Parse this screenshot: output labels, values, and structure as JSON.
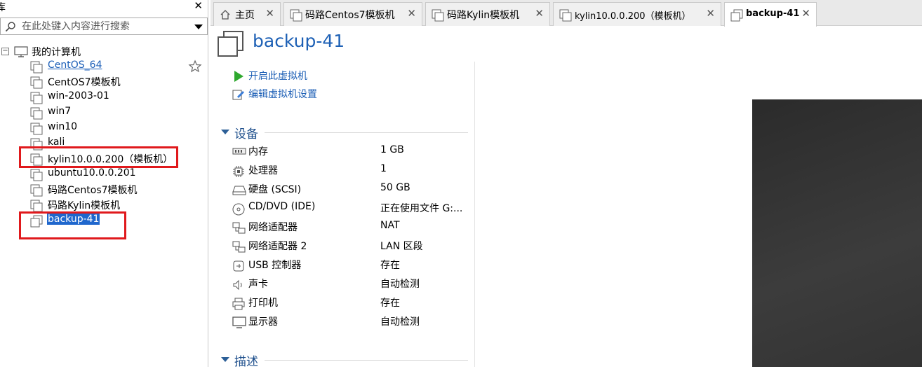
{
  "library": {
    "title": "库",
    "search_placeholder": "在此处键入内容进行搜索",
    "root_label": "我的计算机",
    "items": [
      {
        "label": "CentOS_64"
      },
      {
        "label": "CentOS7模板机"
      },
      {
        "label": "win-2003-01"
      },
      {
        "label": "win7"
      },
      {
        "label": "win10"
      },
      {
        "label": "kali"
      },
      {
        "label": "kylin10.0.0.200（模板机）"
      },
      {
        "label": "ubuntu10.0.0.201"
      },
      {
        "label": "码路Centos7模板机"
      },
      {
        "label": "码路Kylin模板机"
      },
      {
        "label": "backup-41"
      }
    ]
  },
  "tabs": [
    {
      "label": "主页",
      "icon": "home-icon"
    },
    {
      "label": "码路Centos7模板机",
      "icon": "vm-icon"
    },
    {
      "label": "码路Kylin模板机",
      "icon": "vm-icon"
    },
    {
      "label": "kylin10.0.0.200（模板机）",
      "icon": "vm-icon"
    },
    {
      "label": "backup-41",
      "icon": "vm-clone-icon",
      "active": true
    }
  ],
  "vm": {
    "title": "backup-41",
    "actions": [
      {
        "label": "开启此虚拟机",
        "icon": "play-icon"
      },
      {
        "label": "编辑虚拟机设置",
        "icon": "edit-settings-icon"
      }
    ],
    "devices_header": "设备",
    "devices": [
      {
        "name": "内存",
        "value": "1 GB",
        "icon": "memory-icon"
      },
      {
        "name": "处理器",
        "value": "1",
        "icon": "cpu-icon"
      },
      {
        "name": "硬盘 (SCSI)",
        "value": "50 GB",
        "icon": "disk-icon"
      },
      {
        "name": "CD/DVD (IDE)",
        "value": "正在使用文件 G:...",
        "icon": "cd-icon"
      },
      {
        "name": "网络适配器",
        "value": "NAT",
        "icon": "network-icon"
      },
      {
        "name": "网络适配器 2",
        "value": "LAN 区段",
        "icon": "network-icon"
      },
      {
        "name": "USB 控制器",
        "value": "存在",
        "icon": "usb-icon"
      },
      {
        "name": "声卡",
        "value": "自动检测",
        "icon": "speaker-icon"
      },
      {
        "name": "打印机",
        "value": "存在",
        "icon": "printer-icon"
      },
      {
        "name": "显示器",
        "value": "自动检测",
        "icon": "monitor-icon"
      }
    ],
    "description_header": "描述"
  },
  "colors": {
    "accent": "#1f67cd",
    "highlight_box": "#e0191c",
    "title_blue": "#1d60b5"
  }
}
